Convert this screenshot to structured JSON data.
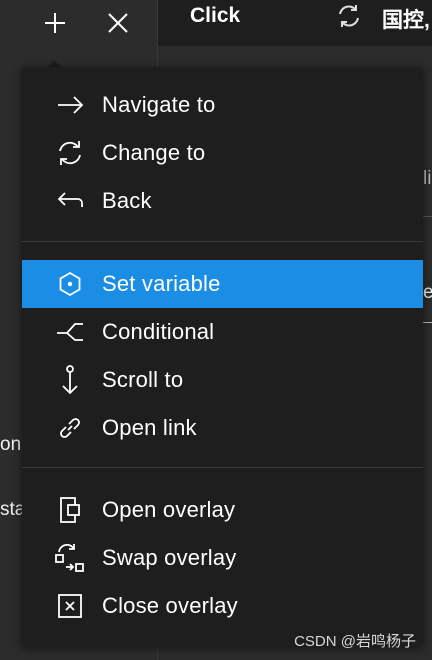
{
  "toolbar": {
    "add_icon": "plus-icon",
    "close_icon": "close-icon"
  },
  "header": {
    "trigger_label": "Click",
    "swap_icon": "swap-icon",
    "target_text": "国控,"
  },
  "background_fragments": {
    "left_on": "on",
    "left_sta": "sta",
    "right_li": "li",
    "right_e": "e"
  },
  "menu": {
    "group1": [
      {
        "label": "Navigate to",
        "icon": "arrow-right-icon"
      },
      {
        "label": "Change to",
        "icon": "refresh-icon"
      },
      {
        "label": "Back",
        "icon": "back-arrow-icon"
      }
    ],
    "group2": [
      {
        "label": "Set variable",
        "icon": "hexagon-dot-icon",
        "selected": true
      },
      {
        "label": "Conditional",
        "icon": "branch-icon"
      },
      {
        "label": "Scroll to",
        "icon": "anchor-icon"
      },
      {
        "label": "Open link",
        "icon": "link-icon"
      }
    ],
    "group3": [
      {
        "label": "Open overlay",
        "icon": "overlay-icon"
      },
      {
        "label": "Swap overlay",
        "icon": "swap-overlay-icon"
      },
      {
        "label": "Close overlay",
        "icon": "close-overlay-icon"
      }
    ],
    "selected_color": "#1b8de4"
  },
  "watermark": "CSDN @岩鸣杨子"
}
